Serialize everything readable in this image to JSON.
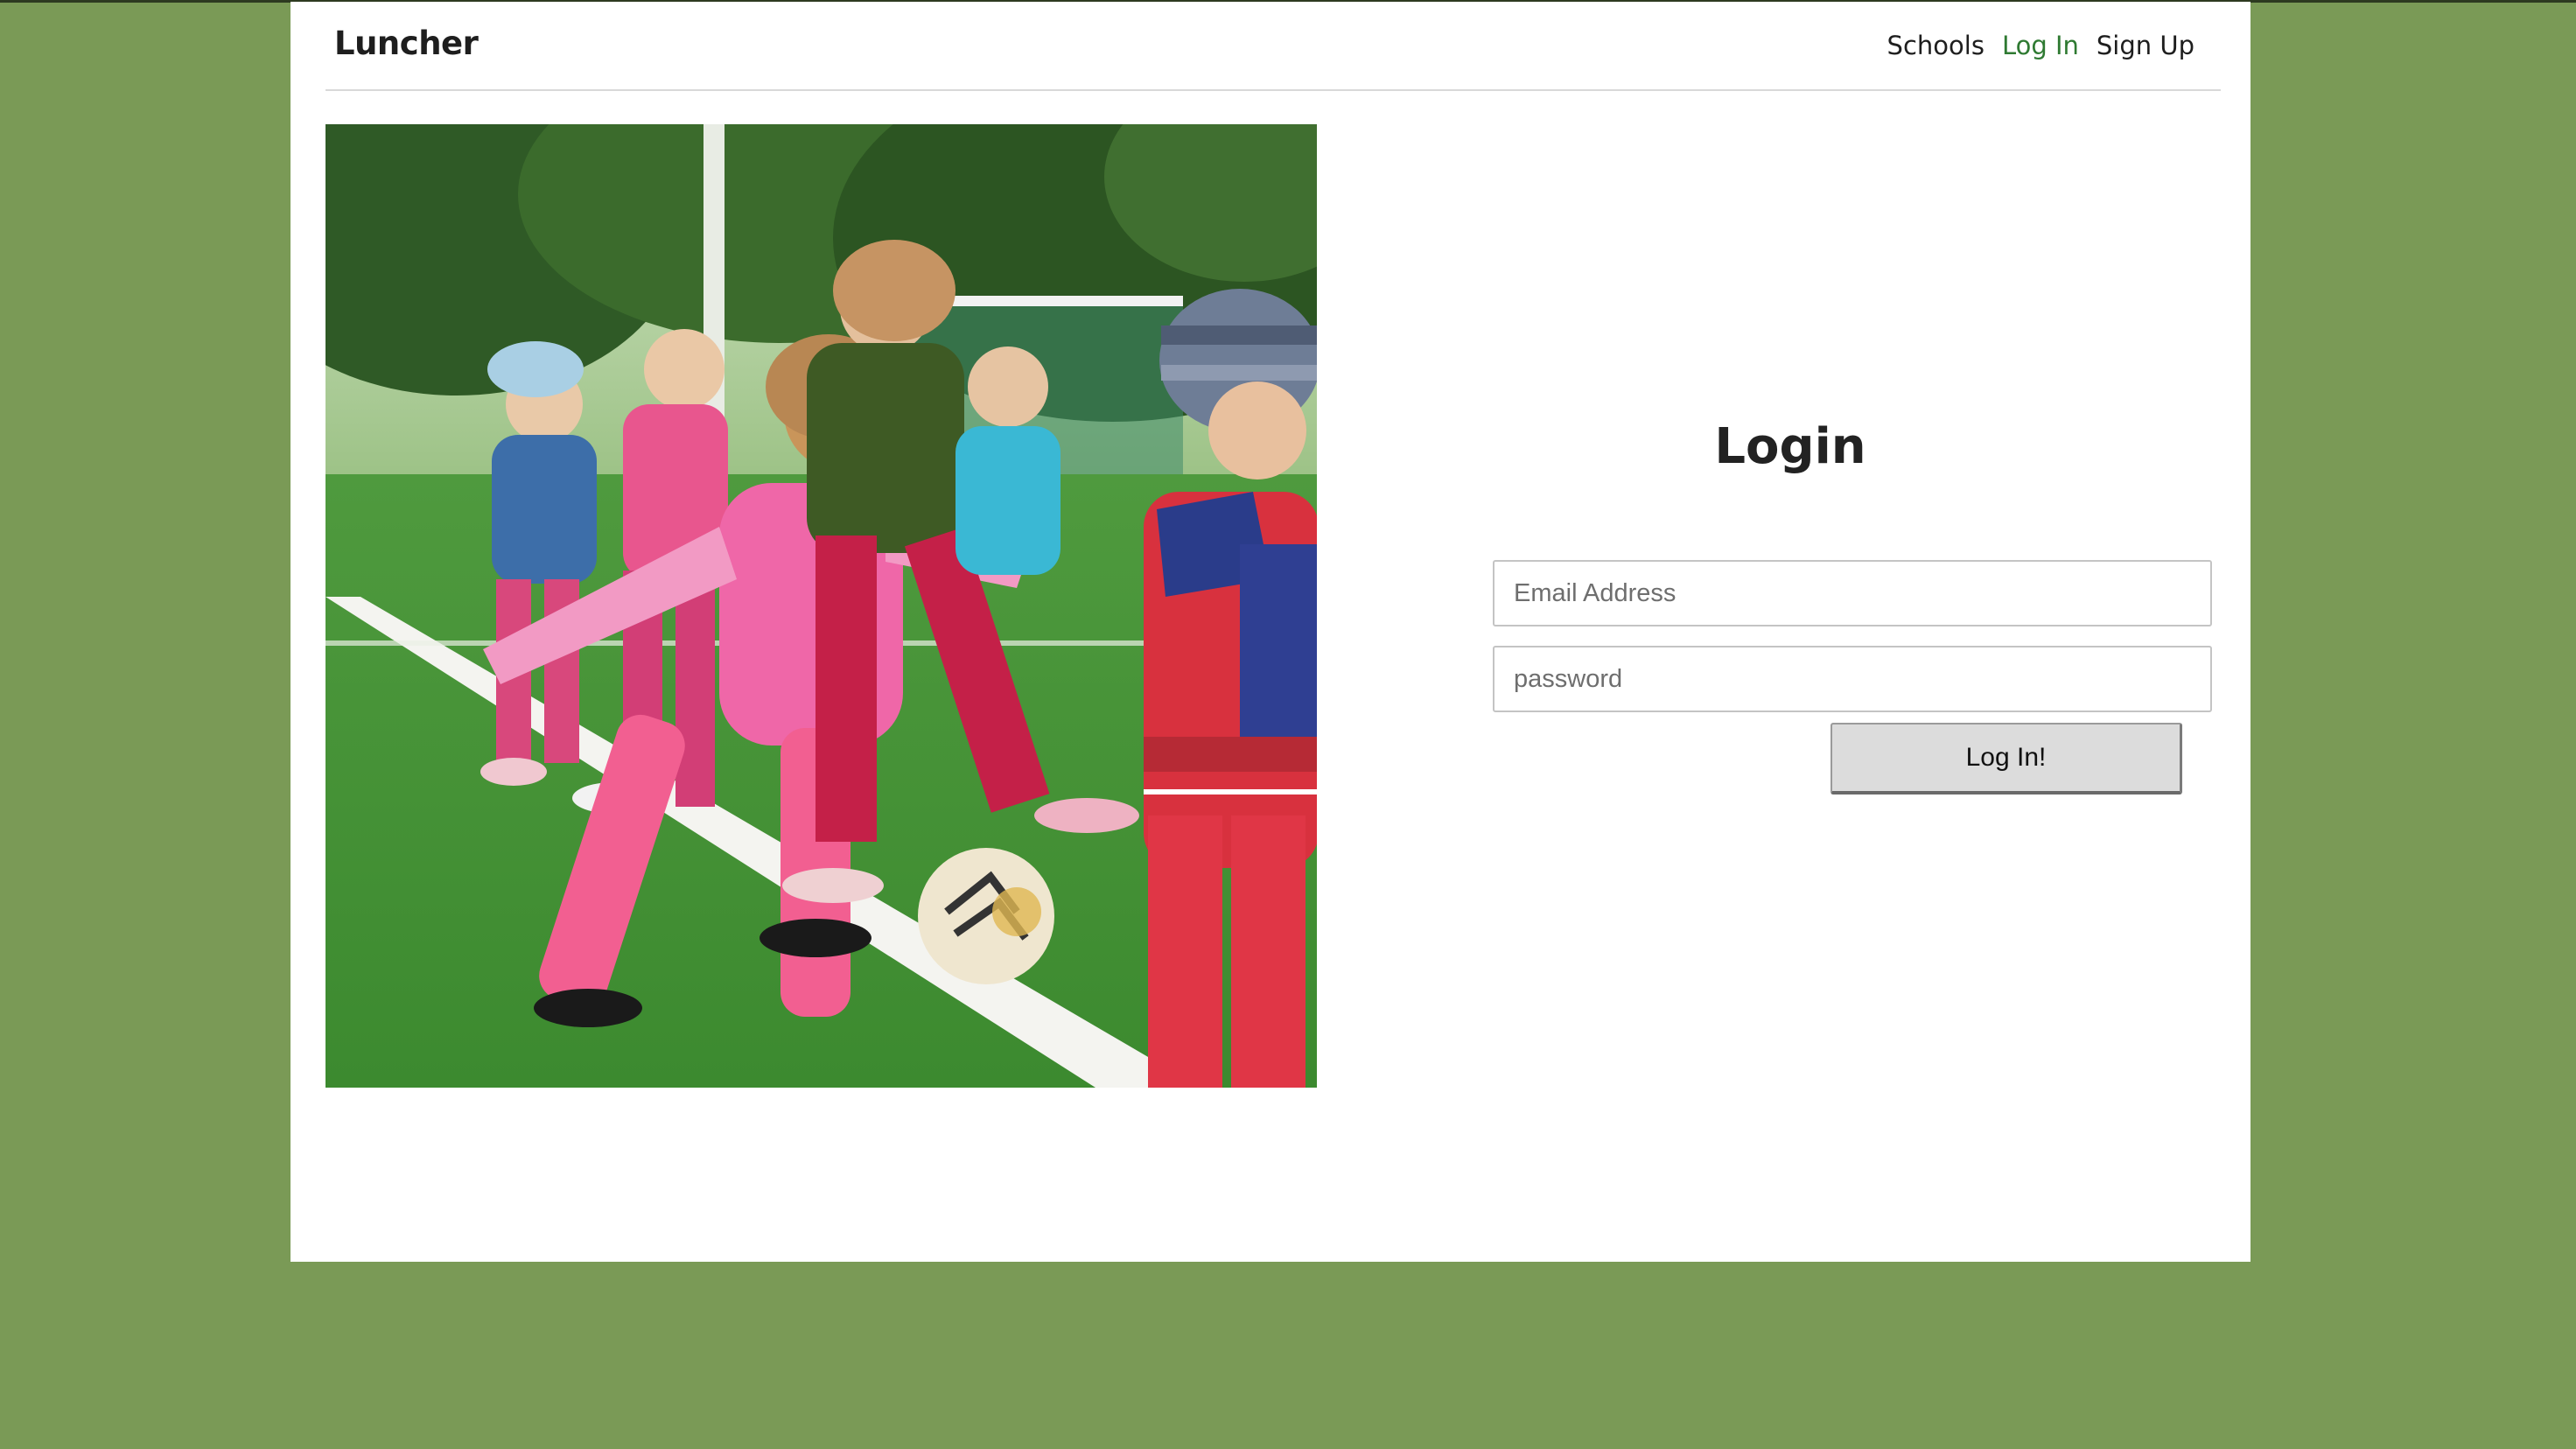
{
  "app": {
    "brand": "Luncher"
  },
  "nav": {
    "items": [
      {
        "label": "Schools",
        "active": false
      },
      {
        "label": "Log In",
        "active": true
      },
      {
        "label": "Sign Up",
        "active": false
      }
    ],
    "active_color": "#2f7a32"
  },
  "login": {
    "title": "Login",
    "email_placeholder": "Email Address",
    "password_placeholder": "password",
    "submit_label": "Log In!"
  },
  "theme": {
    "background": "#7a9a56",
    "card": "#ffffff"
  }
}
